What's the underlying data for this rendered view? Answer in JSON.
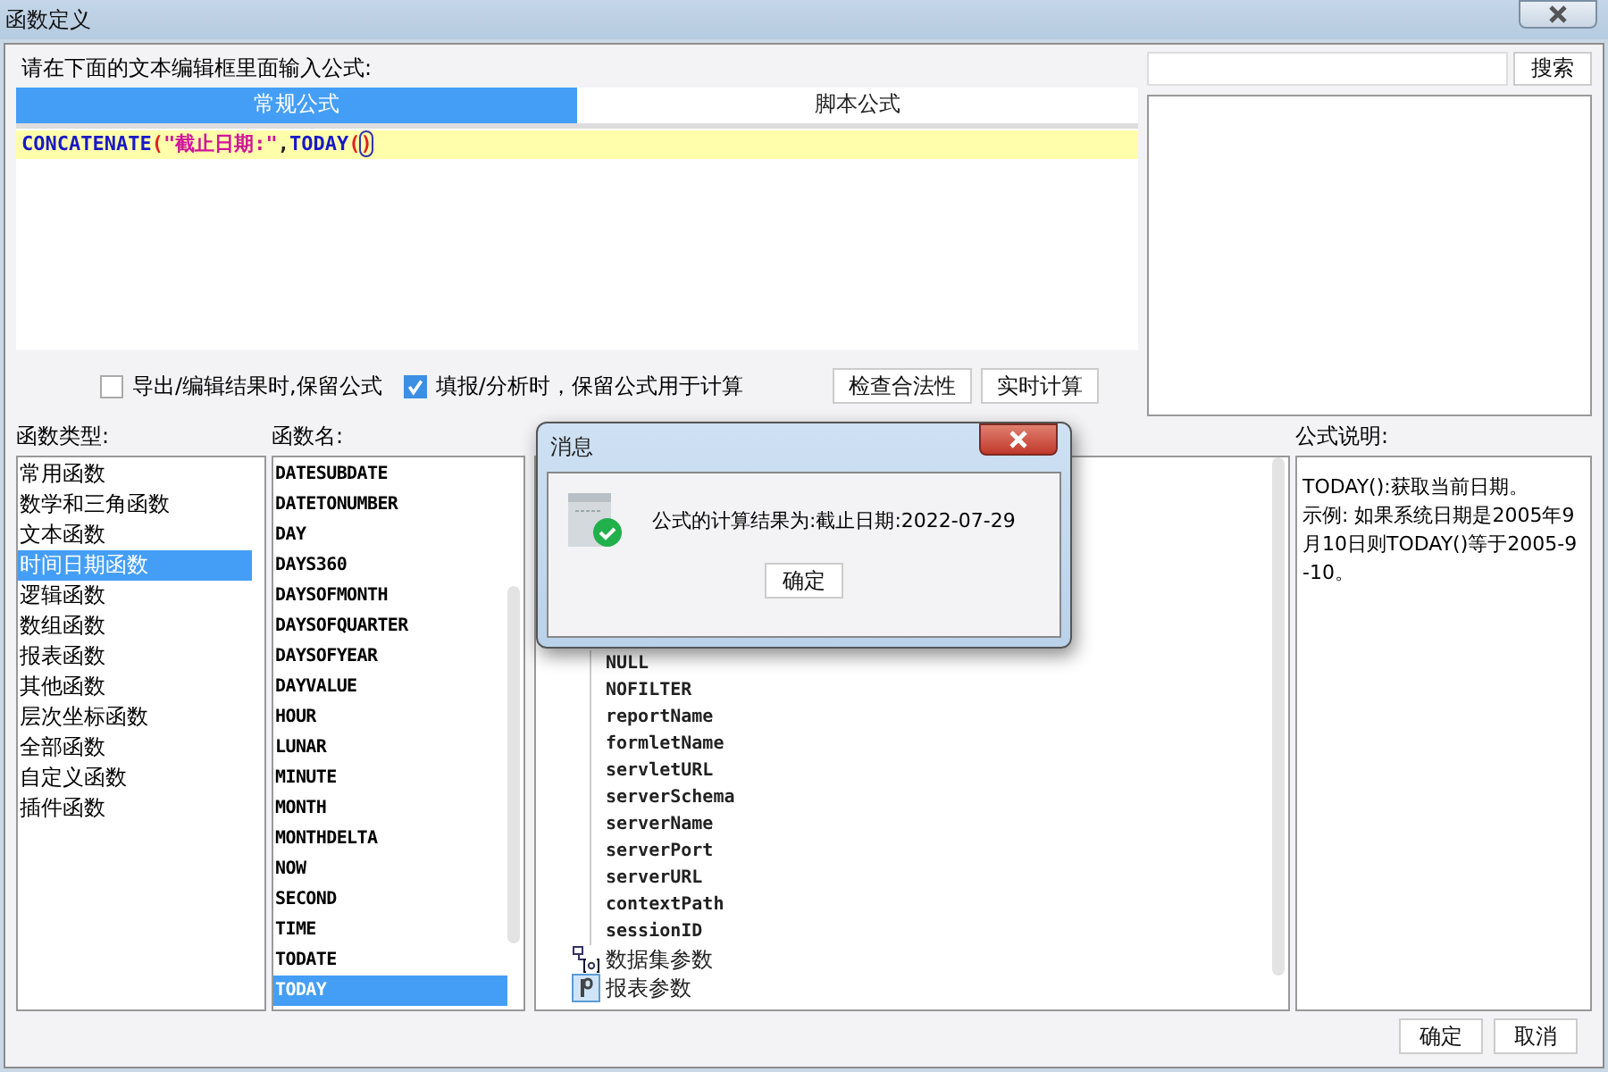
{
  "window": {
    "title": "函数定义"
  },
  "prompt": "请在下面的文本编辑框里面输入公式:",
  "tabs": [
    {
      "label": "常规公式",
      "selected": true
    },
    {
      "label": "脚本公式",
      "selected": false
    }
  ],
  "formula": [
    {
      "kind": "func",
      "text": "CONCATENATE"
    },
    {
      "kind": "paren",
      "text": "("
    },
    {
      "kind": "string",
      "text": "\"截止日期:\""
    },
    {
      "kind": "plain",
      "text": ","
    },
    {
      "kind": "func",
      "text": "TODAY"
    },
    {
      "kind": "paren",
      "text": "("
    },
    {
      "kind": "paren",
      "text": ")",
      "highlighted": true
    }
  ],
  "search": {
    "button": "搜索"
  },
  "options": [
    {
      "label": "导出/编辑结果时,保留公式",
      "checked": false
    },
    {
      "label": "填报/分析时，保留公式用于计算",
      "checked": true
    }
  ],
  "actions": [
    "检查合法性",
    "实时计算"
  ],
  "type_list": {
    "label": "函数类型:",
    "items": [
      {
        "label": "常用函数",
        "selected": false
      },
      {
        "label": "数学和三角函数",
        "selected": false
      },
      {
        "label": "文本函数",
        "selected": false
      },
      {
        "label": "时间日期函数",
        "selected": true
      },
      {
        "label": "逻辑函数",
        "selected": false
      },
      {
        "label": "数组函数",
        "selected": false
      },
      {
        "label": "报表函数",
        "selected": false
      },
      {
        "label": "其他函数",
        "selected": false
      },
      {
        "label": "层次坐标函数",
        "selected": false
      },
      {
        "label": "全部函数",
        "selected": false
      },
      {
        "label": "自定义函数",
        "selected": false
      },
      {
        "label": "插件函数",
        "selected": false
      }
    ]
  },
  "name_list": {
    "label": "函数名:",
    "items": [
      {
        "label": "DATESUBDATE",
        "selected": false
      },
      {
        "label": "DATETONUMBER",
        "selected": false
      },
      {
        "label": "DAY",
        "selected": false
      },
      {
        "label": "DAYS360",
        "selected": false
      },
      {
        "label": "DAYSOFMONTH",
        "selected": false
      },
      {
        "label": "DAYSOFQUARTER",
        "selected": false
      },
      {
        "label": "DAYSOFYEAR",
        "selected": false
      },
      {
        "label": "DAYVALUE",
        "selected": false
      },
      {
        "label": "HOUR",
        "selected": false
      },
      {
        "label": "LUNAR",
        "selected": false
      },
      {
        "label": "MINUTE",
        "selected": false
      },
      {
        "label": "MONTH",
        "selected": false
      },
      {
        "label": "MONTHDELTA",
        "selected": false
      },
      {
        "label": "NOW",
        "selected": false
      },
      {
        "label": "SECOND",
        "selected": false
      },
      {
        "label": "TIME",
        "selected": false
      },
      {
        "label": "TODATE",
        "selected": false
      },
      {
        "label": "TODAY",
        "selected": true
      }
    ]
  },
  "tree": [
    {
      "children": [
        {
          "label": "NULL"
        },
        {
          "label": "NOFILTER"
        },
        {
          "label": "reportName"
        },
        {
          "label": "formletName"
        },
        {
          "label": "servletURL"
        },
        {
          "label": "serverSchema"
        },
        {
          "label": "serverName"
        },
        {
          "label": "serverPort"
        },
        {
          "label": "serverURL"
        },
        {
          "label": "contextPath"
        },
        {
          "label": "sessionID"
        }
      ]
    },
    {
      "kind": "dataset",
      "label": "数据集参数"
    },
    {
      "kind": "param",
      "label": "报表参数"
    }
  ],
  "description": {
    "label": "公式说明:",
    "lines": [
      "TODAY():获取当前日期。",
      "示例: 如果系统日期是2005年9月10日则TODAY()等于2005-9-10。"
    ]
  },
  "footer": [
    "确定",
    "取消"
  ],
  "message": {
    "title": "消息",
    "text": "公式的计算结果为:截止日期:2022-07-29",
    "button": "确定"
  }
}
